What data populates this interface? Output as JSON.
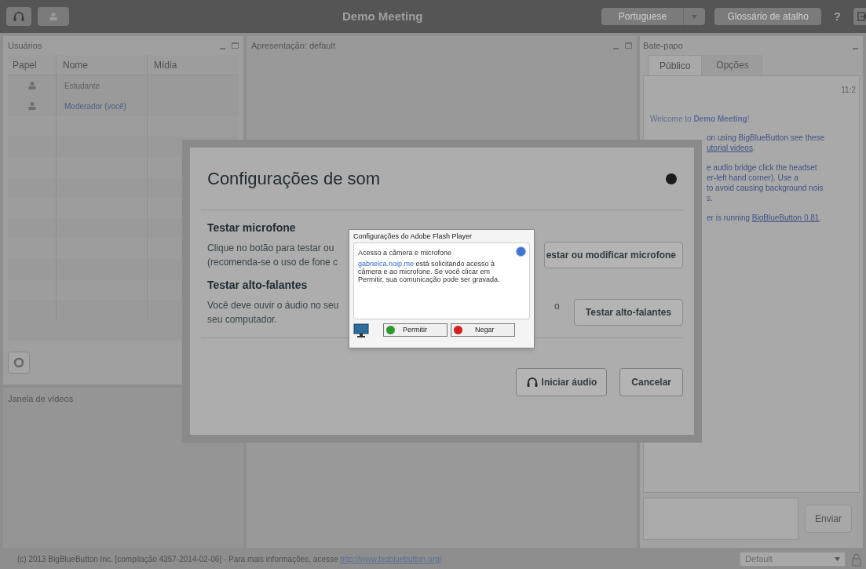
{
  "top_bar": {
    "title": "Demo Meeting",
    "language": "Portuguese",
    "shortcuts_button": "Glossário de atalho",
    "help": "?"
  },
  "users_panel": {
    "title": "Usuários",
    "columns": [
      "Papel",
      "Nome",
      "Mídia"
    ],
    "rows": [
      {
        "name": "Estudante",
        "me": false
      },
      {
        "name": "Moderador (você)",
        "me": true
      }
    ]
  },
  "video_panel": {
    "title": "Janela de vídeos"
  },
  "presentation_panel": {
    "title": "Apresentação: default"
  },
  "chat_panel": {
    "title": "Bate-papo",
    "tabs": [
      {
        "label": "Público",
        "selected": true
      },
      {
        "label": "Opções",
        "selected": false
      }
    ],
    "time": "11:2",
    "welcome": "Welcome to **Demo Meeting**!",
    "lines": [
      {
        "before": "on using BigBlueButton see these"
      },
      {
        "link": "utorial videos",
        "after": "."
      },
      {
        "before": "e audio bridge click the headset"
      },
      {
        "before": "er-left hand corner).  Use a"
      },
      {
        "before": "to avoid causing background nois"
      },
      {
        "before": "s."
      },
      {
        "before": "er is running ",
        "link": "BigBlueButton 0.81",
        "after": "."
      }
    ],
    "send_button": "Enviar"
  },
  "footer": {
    "text": "(c) 2013 BigBlueButton Inc. [compilação 4357-2014-02-06] - Para mais informações, acesse ",
    "link": "http://www.bigbluebutton.org/",
    "layout": "Default"
  },
  "sound_dialog": {
    "title": "Configurações de som",
    "mic_heading": "Testar microfone",
    "mic_text": [
      "Clique no botão para testar ou",
      "(recomenda-se o uso de fone c"
    ],
    "mic_button": "estar ou modificar microfone",
    "speaker_heading": "Testar alto-falantes",
    "speaker_text": [
      "Você deve ouvir o áudio no seu",
      "seu computador."
    ],
    "speaker_text_tail": "o",
    "speaker_button": "Testar alto-falantes",
    "start_button": "Iniciar áudio",
    "cancel_button": "Cancelar"
  },
  "flash_dialog": {
    "title": "Configurações do Adobe Flash Player",
    "heading": "Acesso a câmera e microfone",
    "site": "gabrielca.noip.me",
    "message": " está solicitando acesso à câmera e ao microfone. Se você clicar em Permitir, sua comunicação pode ser gravada.",
    "allow": "Permitir",
    "deny": "Negar"
  }
}
